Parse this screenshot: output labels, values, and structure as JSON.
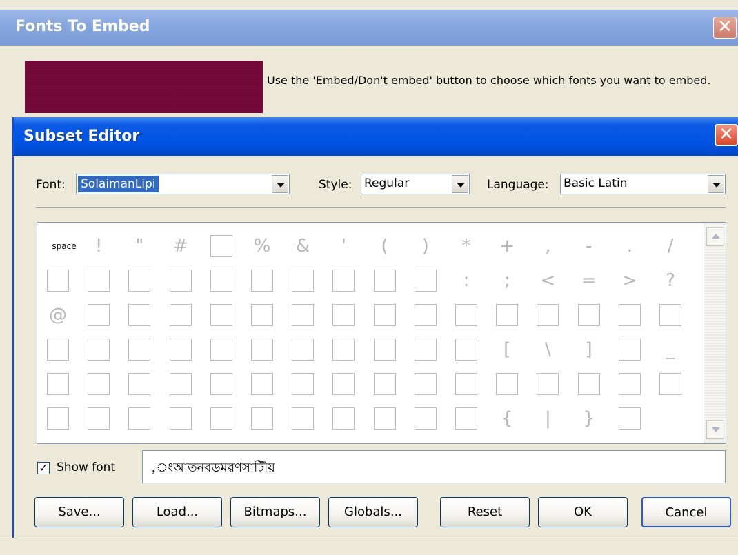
{
  "back_dialog": {
    "title": "Fonts To Embed",
    "close_glyph": "✕",
    "instructions": "Use the 'Embed/Don't embed' button to choose which fonts you want to embed.",
    "swatch_color": "#7a0a3c"
  },
  "subset_editor": {
    "title": "Subset Editor",
    "close_glyph": "✕",
    "font_label": "Font:",
    "font_value": "SolaimanLipi",
    "style_label": "Style:",
    "style_value": "Regular",
    "language_label": "Language:",
    "language_value": "Basic Latin",
    "grid": {
      "rows": [
        [
          "space",
          "!",
          "\"",
          "#",
          "□",
          "%",
          "&",
          "'",
          "(",
          ")",
          "*",
          "+",
          ",",
          "-",
          ".",
          "/"
        ],
        [
          "□",
          "□",
          "□",
          "□",
          "□",
          "□",
          "□",
          "□",
          "□",
          "□",
          ":",
          ";",
          "<",
          "=",
          ">",
          "?"
        ],
        [
          "@",
          "□",
          "□",
          "□",
          "□",
          "□",
          "□",
          "□",
          "□",
          "□",
          "□",
          "□",
          "□",
          "□",
          "□",
          "□"
        ],
        [
          "□",
          "□",
          "□",
          "□",
          "□",
          "□",
          "□",
          "□",
          "□",
          "□",
          "□",
          "[",
          "\\",
          "]",
          "□",
          "_"
        ],
        [
          "□",
          "□",
          "□",
          "□",
          "□",
          "□",
          "□",
          "□",
          "□",
          "□",
          "□",
          "□",
          "□",
          "□",
          "□",
          "□"
        ],
        [
          "□",
          "□",
          "□",
          "□",
          "□",
          "□",
          "□",
          "□",
          "□",
          "□",
          "□",
          "{",
          "|",
          "}",
          "□",
          ""
        ]
      ]
    },
    "show_font_label": "Show font",
    "show_font_checked": "✓",
    "show_font_text": ",ংআতনবডমৱণসাটিৗয়",
    "buttons": {
      "save": "Save...",
      "load": "Load...",
      "bitmaps": "Bitmaps...",
      "globals": "Globals...",
      "reset": "Reset",
      "ok": "OK",
      "cancel": "Cancel"
    }
  }
}
